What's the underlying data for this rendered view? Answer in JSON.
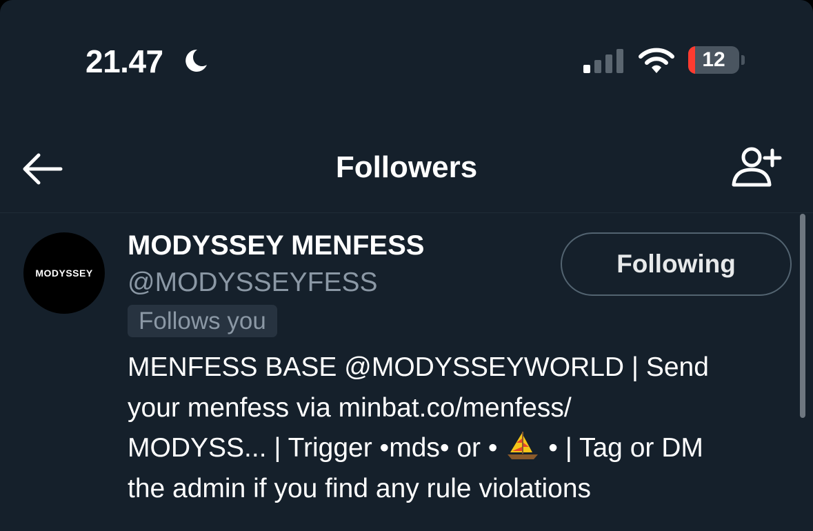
{
  "status_bar": {
    "time": "21.47",
    "battery_level": "12"
  },
  "header": {
    "title": "Followers"
  },
  "follower": {
    "avatar_text": "MODYSSEY",
    "display_name": "MODYSSEY MENFESS",
    "handle": "@MODYSSEYFESS",
    "follows_you_label": "Follows you",
    "follow_button_label": "Following",
    "bio": {
      "line1": "MENFESS BASE @MODYSSEYWORLD | Send",
      "line2": "your menfess via minbat.co/menfess/",
      "line3_start": "MODYSS... | Trigger •mds• or •",
      "line3_end": "• | Tag or DM",
      "line4": "the admin if you find any rule violations"
    }
  },
  "colors": {
    "background": "#15202b",
    "text_primary": "#ffffff",
    "text_secondary": "#8b98a5",
    "battery_low": "#ff3b30",
    "button_border": "#536471"
  },
  "icons": {
    "status": [
      "moon-icon",
      "signal-icon",
      "wifi-icon",
      "battery-icon"
    ],
    "header": [
      "back-arrow-icon",
      "add-user-icon"
    ],
    "bio_emoji": "sailboat-icon"
  }
}
